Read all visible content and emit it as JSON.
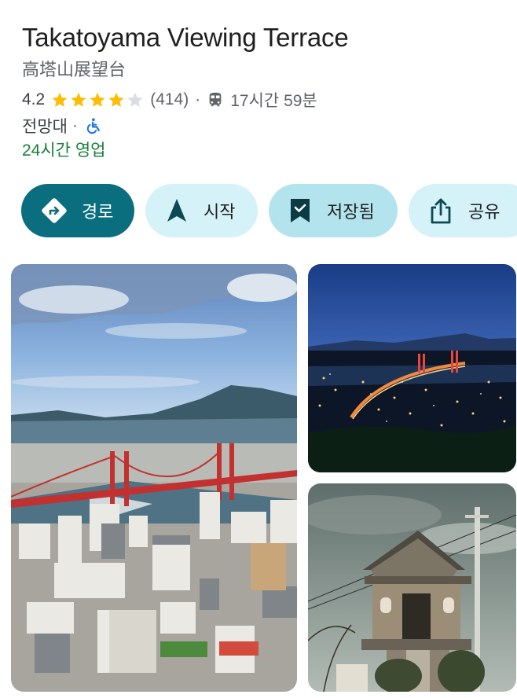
{
  "place": {
    "title": "Takatoyama Viewing Terrace",
    "subtitle": "高塔山展望台",
    "rating": "4.2",
    "stars": 4,
    "reviews": "(414)",
    "transit_time": "17시간 59분",
    "category": "전망대",
    "category_sep": "·",
    "rating_sep": "·",
    "hours": "24시간 영업"
  },
  "icons": {
    "star": "star-icon",
    "transit": "train-icon",
    "accessible": "wheelchair-icon",
    "route": "directions-icon",
    "start": "navigation-arrow-icon",
    "saved": "bookmark-check-icon",
    "share": "share-icon"
  },
  "actions": {
    "route_label": "경로",
    "start_label": "시작",
    "saved_label": "저장됨",
    "share_label": "공유"
  },
  "colors": {
    "accent": "#0b6e7f",
    "star": "#fbbc04",
    "open": "#188038",
    "chip": "#d5f2f8",
    "chip_active": "#b3e4ee"
  }
}
